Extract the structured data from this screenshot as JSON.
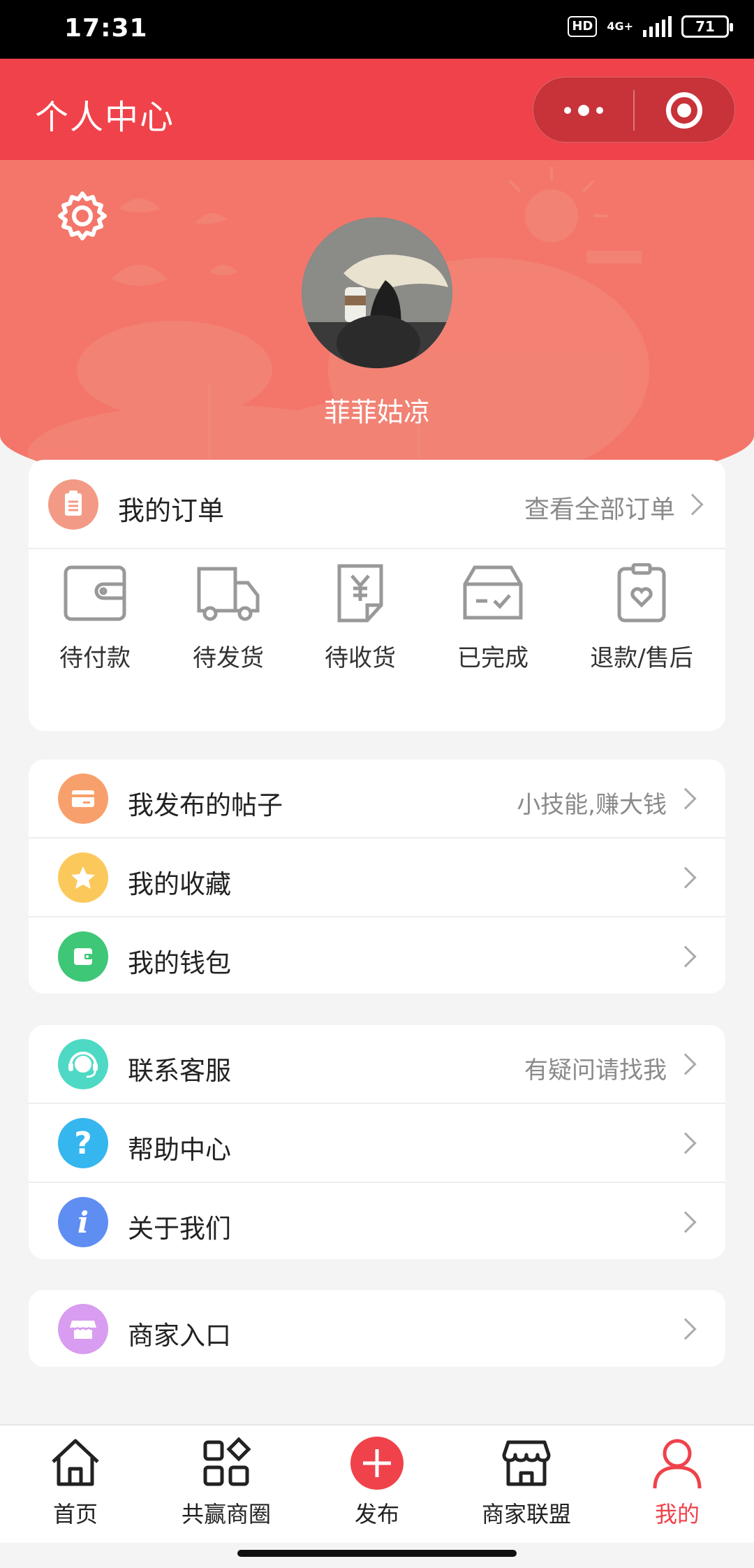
{
  "status_bar": {
    "time": "17:31",
    "hd": "HD",
    "network": "4G+",
    "battery": "71"
  },
  "header": {
    "title": "个人中心"
  },
  "profile": {
    "username": "菲菲姑凉"
  },
  "orders": {
    "title": "我的订单",
    "view_all": "查看全部订单",
    "items": [
      {
        "label": "待付款",
        "icon": "wallet-icon"
      },
      {
        "label": "待发货",
        "icon": "truck-icon"
      },
      {
        "label": "待收货",
        "icon": "receipt-yen-icon"
      },
      {
        "label": "已完成",
        "icon": "box-check-icon"
      },
      {
        "label": "退款/售后",
        "icon": "clipboard-heart-icon"
      }
    ]
  },
  "menu_group1": [
    {
      "label": "我发布的帖子",
      "hint": "小技能,赚大钱",
      "icon": "card-icon",
      "color": "#f8a06b"
    },
    {
      "label": "我的收藏",
      "hint": "",
      "icon": "star-icon",
      "color": "#fbc95b"
    },
    {
      "label": "我的钱包",
      "hint": "",
      "icon": "wallet-icon",
      "color": "#3ec777"
    }
  ],
  "menu_group2": [
    {
      "label": "联系客服",
      "hint": "有疑问请找我",
      "icon": "headset-icon",
      "color": "#4ed9c4"
    },
    {
      "label": "帮助中心",
      "hint": "",
      "icon": "question-icon",
      "color": "#35b6ee"
    },
    {
      "label": "关于我们",
      "hint": "",
      "icon": "info-icon",
      "color": "#5f8ef2"
    }
  ],
  "menu_group3": [
    {
      "label": "商家入口",
      "hint": "",
      "icon": "store-icon",
      "color": "#d89cf0"
    }
  ],
  "tabbar": [
    {
      "label": "首页",
      "icon": "home-icon"
    },
    {
      "label": "共赢商圈",
      "icon": "grid-apps-icon"
    },
    {
      "label": "发布",
      "icon": "plus-circle-icon"
    },
    {
      "label": "商家联盟",
      "icon": "shop-icon"
    },
    {
      "label": "我的",
      "icon": "user-icon",
      "active": true
    }
  ],
  "colors": {
    "brand": "#ef424a",
    "banner": "#f4766a"
  }
}
